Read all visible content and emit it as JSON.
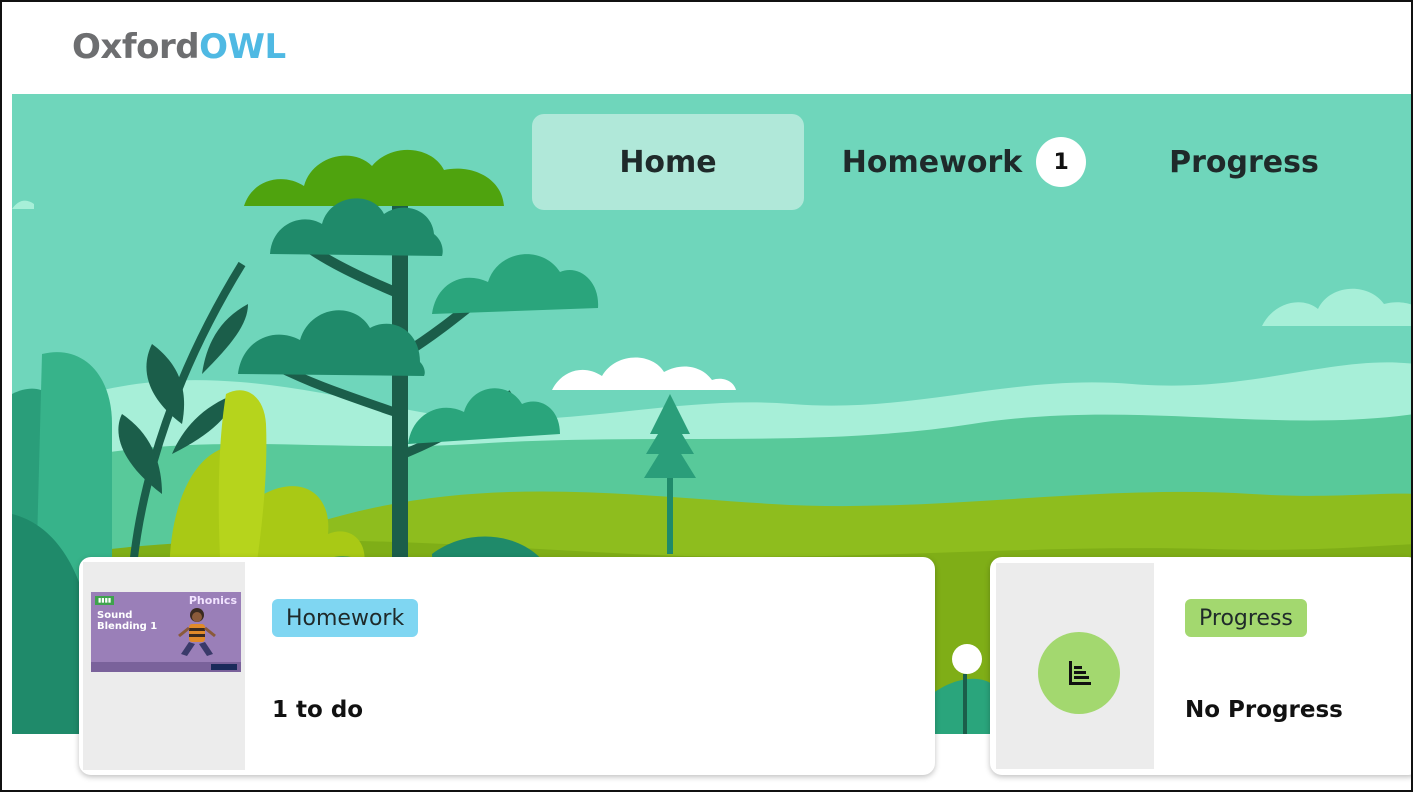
{
  "header": {
    "logo_part1": "Oxford",
    "logo_part2": "OWL"
  },
  "nav": {
    "home_label": "Home",
    "homework_label": "Homework",
    "homework_badge": "1",
    "progress_label": "Progress",
    "active": "Home"
  },
  "cards": {
    "homework": {
      "tag": "Homework",
      "value": "1 to do",
      "book": {
        "series": "Phonics",
        "title": "Sound Blending 1"
      }
    },
    "progress": {
      "tag": "Progress",
      "value": "No Progress",
      "icon": "bar-chart-icon"
    }
  },
  "colors": {
    "hero_bg": "#6fd6bb",
    "logo_gray": "#6d6e70",
    "logo_blue": "#4fb9e3",
    "homework_tag": "#7fd6f2",
    "progress_tag": "#a3d86f"
  }
}
